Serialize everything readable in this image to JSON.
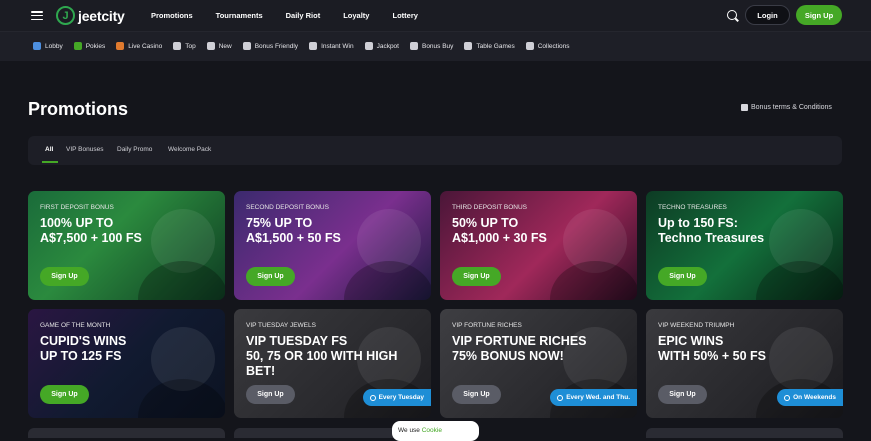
{
  "header": {
    "logo": "jeetcity",
    "nav": [
      "Promotions",
      "Tournaments",
      "Daily Riot",
      "Loyalty",
      "Lottery"
    ],
    "login_label": "Login",
    "signup_label": "Sign Up"
  },
  "categories": [
    {
      "label": "Lobby",
      "icon": "lobby-icon",
      "color": "#4d8fe0"
    },
    {
      "label": "Pokies",
      "icon": "pokies-icon",
      "color": "#45a826"
    },
    {
      "label": "Live Casino",
      "icon": "live-casino-icon",
      "color": "#e07a2e"
    },
    {
      "label": "Top",
      "icon": "star-icon",
      "color": "#cfcfd6"
    },
    {
      "label": "New",
      "icon": "new-icon",
      "color": "#cfcfd6"
    },
    {
      "label": "Bonus Friendly",
      "icon": "bonus-icon",
      "color": "#cfcfd6"
    },
    {
      "label": "Instant Win",
      "icon": "lightning-icon",
      "color": "#cfcfd6"
    },
    {
      "label": "Jackpot",
      "icon": "diamond-icon",
      "color": "#cfcfd6"
    },
    {
      "label": "Bonus Buy",
      "icon": "bonus-buy-icon",
      "color": "#cfcfd6"
    },
    {
      "label": "Table Games",
      "icon": "table-games-icon",
      "color": "#cfcfd6"
    },
    {
      "label": "Collections",
      "icon": "collections-icon",
      "color": "#cfcfd6"
    }
  ],
  "page": {
    "title": "Promotions",
    "terms_link": "Bonus terms & Conditions",
    "tabs": [
      "All",
      "VIP Bonuses",
      "Daily Promo",
      "Welcome Pack"
    ]
  },
  "cards": [
    {
      "label": "FIRST DEPOSIT BONUS",
      "headline": "100% UP TO\nA$7,500 + 100 FS",
      "button": "Sign Up",
      "badge": ""
    },
    {
      "label": "SECOND DEPOSIT BONUS",
      "headline": "75% UP TO\nA$1,500 + 50 FS",
      "button": "Sign Up",
      "badge": ""
    },
    {
      "label": "THIRD DEPOSIT BONUS",
      "headline": "50% UP TO\nA$1,000 + 30 FS",
      "button": "Sign Up",
      "badge": ""
    },
    {
      "label": "Techno Treasures",
      "headline": "Up to 150 FS:\nTechno Treasures",
      "button": "Sign Up",
      "badge": ""
    },
    {
      "label": "GAME OF THE MONTH",
      "headline": "CUPID'S WINS\nUP TO 125 FS",
      "button": "Sign Up",
      "badge": ""
    },
    {
      "label": "VIP TUESDAY JEWELS",
      "headline": "VIP TUESDAY FS\n50, 75 OR 100 WITH HIGH\nBET!",
      "button": "Sign Up",
      "badge": "Every Tuesday"
    },
    {
      "label": "VIP FORTUNE RICHES",
      "headline": "VIP FORTUNE RICHES\n75% BONUS NOW!",
      "button": "Sign Up",
      "badge": "Every Wed. and Thu."
    },
    {
      "label": "VIP WEEKEND TRIUMPH",
      "headline": "EPIC WINS\nWITH 50% + 50 FS",
      "button": "Sign Up",
      "badge": "On Weekends"
    }
  ],
  "cookie": {
    "text": "We use ",
    "link": "Cookie"
  }
}
